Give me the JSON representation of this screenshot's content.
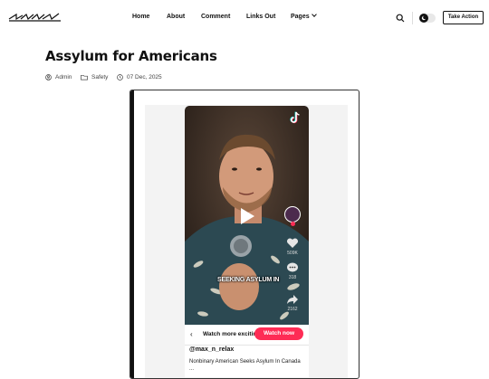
{
  "header": {
    "logo_text": "site logo",
    "nav": {
      "home": "Home",
      "about": "About",
      "comment": "Comment",
      "links_out": "Links Out",
      "pages": "Pages"
    },
    "cta_label": "Take Action"
  },
  "post": {
    "title": "Assylum for Americans",
    "meta": {
      "author": "Admin",
      "category": "Safety",
      "date": "07 Dec, 2025"
    }
  },
  "embed": {
    "platform_icon": "tiktok-icon",
    "caption": "SEEKING ASYLUM IN",
    "likes": "509K",
    "comments": "318",
    "shares": "2162",
    "watch_more": "Watch more exciting videos",
    "watch_now": "Watch now",
    "username": "@max_n_relax",
    "description": "Nonbinary American Seeks Asylum In Canada ..."
  },
  "colors": {
    "accent": "#fe2c55",
    "text": "#111111",
    "video_bg": "#2d2420"
  }
}
